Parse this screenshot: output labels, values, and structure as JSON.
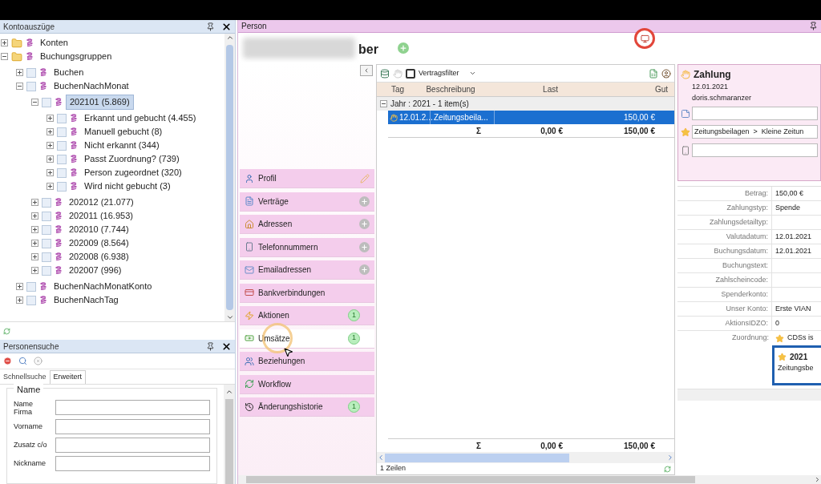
{
  "kontoauszuege": {
    "title": "Kontoauszüge",
    "tree": [
      {
        "label": "Konten",
        "kind": "folder",
        "expanded": false,
        "selected": false
      },
      {
        "label": "Buchungsgruppen",
        "kind": "folder",
        "expanded": true,
        "selected": false,
        "children": [
          {
            "label": "Buchen",
            "kind": "group",
            "checked": false,
            "expanded": false,
            "selected": false
          },
          {
            "label": "BuchenNachMonat",
            "kind": "group",
            "checked": false,
            "expanded": true,
            "selected": false,
            "children": [
              {
                "label": "202101 (5.869)",
                "kind": "group",
                "checked": false,
                "expanded": true,
                "selected": true,
                "children": [
                  {
                    "label": "Erkannt und gebucht (4.455)",
                    "kind": "group",
                    "checked": false,
                    "expanded": false,
                    "selected": false
                  },
                  {
                    "label": "Manuell gebucht (8)",
                    "kind": "group",
                    "checked": false,
                    "expanded": false,
                    "selected": false
                  },
                  {
                    "label": "Nicht erkannt (344)",
                    "kind": "group",
                    "checked": false,
                    "expanded": false,
                    "selected": false
                  },
                  {
                    "label": "Passt Zuordnung? (739)",
                    "kind": "group",
                    "checked": false,
                    "expanded": false,
                    "selected": false
                  },
                  {
                    "label": "Person zugeordnet (320)",
                    "kind": "group",
                    "checked": false,
                    "expanded": false,
                    "selected": false
                  },
                  {
                    "label": "Wird nicht gebucht (3)",
                    "kind": "group",
                    "checked": false,
                    "expanded": false,
                    "selected": false
                  }
                ]
              },
              {
                "label": "202012 (21.077)",
                "kind": "group",
                "checked": false,
                "expanded": false,
                "selected": false
              },
              {
                "label": "202011 (16.953)",
                "kind": "group",
                "checked": false,
                "expanded": false,
                "selected": false
              },
              {
                "label": "202010 (7.744)",
                "kind": "group",
                "checked": false,
                "expanded": false,
                "selected": false
              },
              {
                "label": "202009 (8.564)",
                "kind": "group",
                "checked": false,
                "expanded": false,
                "selected": false
              },
              {
                "label": "202008 (6.938)",
                "kind": "group",
                "checked": false,
                "expanded": false,
                "selected": false
              },
              {
                "label": "202007 (996)",
                "kind": "group",
                "checked": false,
                "expanded": false,
                "selected": false
              }
            ]
          },
          {
            "label": "BuchenNachMonatKonto",
            "kind": "group",
            "checked": false,
            "expanded": false,
            "selected": false
          },
          {
            "label": "BuchenNachTag",
            "kind": "group",
            "checked": false,
            "expanded": false,
            "selected": false
          }
        ]
      }
    ]
  },
  "personensuche": {
    "title": "Personensuche",
    "tabs": [
      {
        "label": "Schnellsuche",
        "selected": false
      },
      {
        "label": "Erweitert",
        "selected": true
      }
    ],
    "section": "Name",
    "fields": [
      {
        "label": "Name Firma"
      },
      {
        "label": "Vorname"
      },
      {
        "label": "Zusatz c/o"
      },
      {
        "label": "Nickname"
      }
    ]
  },
  "person": {
    "title": "Person",
    "name_visible": "ber",
    "nav": [
      {
        "label": "Profil",
        "kind": "edit",
        "selected": false
      },
      {
        "label": "Verträge",
        "kind": "add",
        "selected": false
      },
      {
        "label": "Adressen",
        "kind": "add",
        "selected": false
      },
      {
        "label": "Telefonnummern",
        "kind": "add",
        "selected": false
      },
      {
        "label": "Emailadressen",
        "kind": "add",
        "selected": false
      },
      {
        "label": "Bankverbindungen",
        "kind": "plain",
        "selected": false
      },
      {
        "label": "Aktionen",
        "kind": "count",
        "count": "1",
        "selected": false
      },
      {
        "label": "Umsätze",
        "kind": "count",
        "count": "1",
        "selected": true
      },
      {
        "label": "Beziehungen",
        "kind": "plain",
        "selected": false
      },
      {
        "label": "Workflow",
        "kind": "plain",
        "selected": false
      },
      {
        "label": "Änderungshistorie",
        "kind": "count",
        "count": "1",
        "selected": false
      }
    ],
    "grid": {
      "filter": {
        "label": "Vertragsfilter",
        "checked": false
      },
      "columns": [
        "Tag",
        "Beschreibung",
        "Last",
        "Gut"
      ],
      "group": "Jahr : 2021 - 1 item(s)",
      "rows": [
        {
          "tag": "12.01.2...",
          "beschreibung": "Zeitungsbeila...",
          "gut": "150,00 €",
          "selected": true
        }
      ],
      "summary": {
        "sigma": "Σ",
        "last": "0,00 €",
        "gut": "150,00 €"
      },
      "footer": {
        "sigma": "Σ",
        "last": "0,00 €",
        "gut": "150,00 €"
      },
      "status": "1 Zeilen"
    },
    "detail": {
      "card": {
        "title": "Zahlung",
        "date": "12.01.2021",
        "user": "doris.schmaranzer",
        "lines": [
          {
            "kind": "note"
          },
          {
            "kind": "category",
            "value": "Zeitungsbeilagen  >  Kleine Zeitun"
          },
          {
            "kind": "phone"
          }
        ]
      },
      "rows": [
        {
          "label": "Betrag:",
          "value": "150,00 €"
        },
        {
          "label": "Zahlungstyp:",
          "value": "Spende"
        },
        {
          "label": "Zahlungsdetailtyp:"
        },
        {
          "label": "Valutadatum:",
          "value": "12.01.2021"
        },
        {
          "label": "Buchungsdatum:",
          "value": "12.01.2021"
        },
        {
          "label": "Buchungstext:"
        },
        {
          "label": "Zahlscheincode:"
        },
        {
          "label": "Spenderkonto:"
        },
        {
          "label": "Unser Konto:",
          "value": "Erste VIAN"
        },
        {
          "label": "AktionsIDZO:",
          "value": "0"
        }
      ],
      "zuordnung": {
        "label": "Zuordnung:",
        "value": "CDSs is",
        "box_title": "2021",
        "box_text": "Zeitungsbe"
      }
    }
  }
}
